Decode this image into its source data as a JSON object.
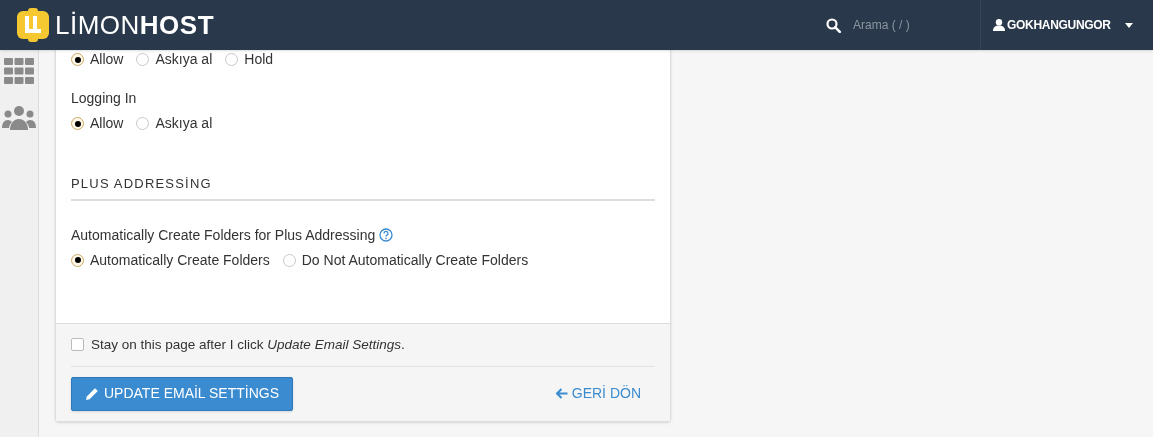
{
  "header": {
    "logo_light": "LİMON",
    "logo_bold": "HOST",
    "search": {
      "placeholder": "Arama ( / )"
    },
    "user": "GOKHANGUNGOR"
  },
  "sections": [
    {
      "groups": [
        {
          "options": [
            {
              "label": "Allow",
              "selected": true
            },
            {
              "label": "Askıya al",
              "selected": false
            },
            {
              "label": "Hold",
              "selected": false
            }
          ]
        },
        {
          "label": "Logging In",
          "options": [
            {
              "label": "Allow",
              "selected": true
            },
            {
              "label": "Askıya al",
              "selected": false
            }
          ]
        }
      ]
    },
    {
      "heading": "PLUS ADDRESSİNG",
      "groups": [
        {
          "label": "Automatically Create Folders for Plus Addressing",
          "help": true,
          "options": [
            {
              "label": "Automatically Create Folders",
              "selected": true
            },
            {
              "label": "Do Not Automatically Create Folders",
              "selected": false
            }
          ]
        }
      ]
    }
  ],
  "footer": {
    "stay": {
      "label": "Stay on this page after I click *Update Email Settings*.",
      "checked": false
    },
    "submit": "UPDATE EMAİL SETTİNGS",
    "back": "GERİ DÖN"
  }
}
